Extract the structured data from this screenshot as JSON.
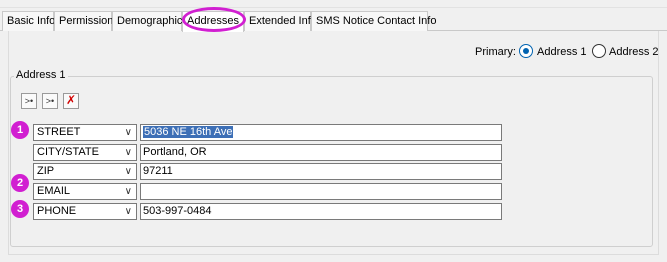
{
  "tabs": [
    {
      "label": "Basic Info",
      "active": false
    },
    {
      "label": "Permission",
      "active": false
    },
    {
      "label": "Demographics",
      "active": false
    },
    {
      "label": "Addresses",
      "active": true
    },
    {
      "label": "Extended Info",
      "active": false
    },
    {
      "label": "SMS Notice Contact Info",
      "active": false
    }
  ],
  "primary": {
    "label": "Primary:",
    "options": [
      {
        "label": "Address 1",
        "selected": true
      },
      {
        "label": "Address 2",
        "selected": false
      }
    ]
  },
  "address_group": {
    "title": "Address 1",
    "toolbar": [
      {
        "icon": "split-icon"
      },
      {
        "icon": "merge-icon"
      },
      {
        "icon": "delete-icon"
      }
    ],
    "rows": [
      {
        "badge": "1",
        "type": "STREET",
        "value": "5036 NE 16th Ave",
        "selected": true
      },
      {
        "badge": "",
        "type": "CITY/STATE",
        "value": "Portland, OR",
        "selected": false
      },
      {
        "badge": "",
        "type": "ZIP",
        "value": "97211",
        "selected": false
      },
      {
        "badge": "2",
        "type": "EMAIL",
        "value": "",
        "selected": false
      },
      {
        "badge": "3",
        "type": "PHONE",
        "value": "503-997-0484",
        "selected": false
      }
    ]
  },
  "colors": {
    "accent": "#d11fd1",
    "radio": "#0063b1",
    "selection": "#3d6fb6"
  }
}
